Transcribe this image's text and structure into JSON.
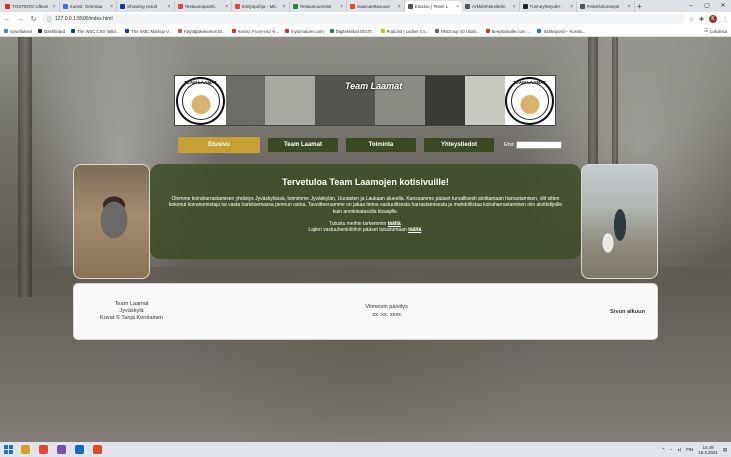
{
  "browser": {
    "tabs": [
      {
        "title": "TOSTERO Ulkoin",
        "color": "#d93025"
      },
      {
        "title": "Kurssi: Orientaa",
        "color": "#4b6bd6"
      },
      {
        "title": "Showing result",
        "color": "#0b3d8c"
      },
      {
        "title": "Testausraportti.",
        "color": "#e8453c"
      },
      {
        "title": "Esityspohja - Mic",
        "color": "#e8453c"
      },
      {
        "title": "Testausuunnitel",
        "color": "#1e8e3e"
      },
      {
        "title": "Saavutettavuusr",
        "color": "#e8453c"
      },
      {
        "title": "Etusivu | Team L",
        "color": "#555555"
      },
      {
        "title": "Arkkitehtiesitelm",
        "color": "#555555"
      },
      {
        "title": "Tunneyhteydet -",
        "color": "#222222"
      },
      {
        "title": "Palvelukonsepti",
        "color": "#555555"
      }
    ],
    "active_tab_index": 7,
    "new_tab_glyph": "+",
    "window_controls": [
      "–",
      "▢",
      "✕"
    ],
    "nav_glyphs": {
      "back": "←",
      "forward": "→",
      "reload": "↻"
    },
    "url": "127.0.0.1:5500/index.html",
    "lock_glyph": "ⓘ",
    "addr_icons": {
      "star": "☆",
      "puzzle": "✱",
      "menu": "⋮"
    },
    "profile_letter": "K",
    "bookmarks": [
      {
        "label": "Sovellukset",
        "color": "#4285f4"
      },
      {
        "label": "Dashboard",
        "color": "#222222"
      },
      {
        "label": "The W3C CSS Valid...",
        "color": "#0b3d8c"
      },
      {
        "label": "The W3C Markup V...",
        "color": "#0b3d8c"
      },
      {
        "label": "Käyttäjäkokemus Di...",
        "color": "#e8453c"
      },
      {
        "label": "Kurssi: Front-end -k...",
        "color": "#d93025"
      },
      {
        "label": "mytomatoes.com",
        "color": "#d93025"
      },
      {
        "label": "Digitekniikat DIGIT...",
        "color": "#1e8e3e"
      },
      {
        "label": "Podcast | Ladies Co...",
        "color": "#f2b100"
      },
      {
        "label": "NNGroup 10 Usab...",
        "color": "#666666"
      },
      {
        "label": "Beeptoskalle.com :...",
        "color": "#d93025"
      },
      {
        "label": "Sähköposti – Korola...",
        "color": "#1a73e8"
      }
    ],
    "reading_list": "Lukulista"
  },
  "page": {
    "banner_title": "Team Laamat",
    "logo_text": "TEAM LAAMAT",
    "nav": [
      {
        "label": "Etusivu",
        "active": true
      },
      {
        "label": "Team Laamat",
        "active": false
      },
      {
        "label": "Toiminta",
        "active": false
      },
      {
        "label": "Yhteystiedot",
        "active": false
      }
    ],
    "search_label": "Etsi:",
    "search_value": "",
    "welcome": {
      "heading": "Tervetuloa Team Laamojen kotisivuille!",
      "paragraph": "Olemme koiraharrastamisen yhdistys Jyväskylässä, toimimme Jyväskylän, Uuraisten ja Laukaan alueella. Kanssamme pääset turvallisesti aloittamaan harrastamisen, olit sitten kokenut koiranomistaja tai vasta harkitsemassa pennun ostoa. Tavoitteenamme on jakaa tietoa vastuullisesta harrastamisesta ja mahdollistaa koiraharrastaminen niin aloittelijoille kuin arvokisatasolla kisaajille.",
      "line1_prefix": "Tutustu meihin tarkemmin ",
      "line1_link": "täältä",
      "line1_suffix": ".",
      "line2_prefix": "Lajien vastuuhenkilöihin pääset tutustumaan ",
      "line2_link": "täältä",
      "line2_suffix": "."
    },
    "footer": {
      "org": "Team Laamat",
      "city": "Jyväskylä",
      "credit": "Kuvat © Tanja Korolainen",
      "updated_label": "Viimeisin päivitys",
      "updated_value": "xx. xx. xxxx",
      "back_to_top": "Sivun alkuun"
    }
  },
  "taskbar": {
    "apps": [
      "#d6a21b",
      "#ea4335",
      "#7b4fb3",
      "#0f6ac9",
      "#d84b20"
    ],
    "tray": {
      "chevron": "^",
      "lang": "FIN",
      "time": "14.49",
      "date": "18.4.2021",
      "notify": "▤"
    }
  }
}
